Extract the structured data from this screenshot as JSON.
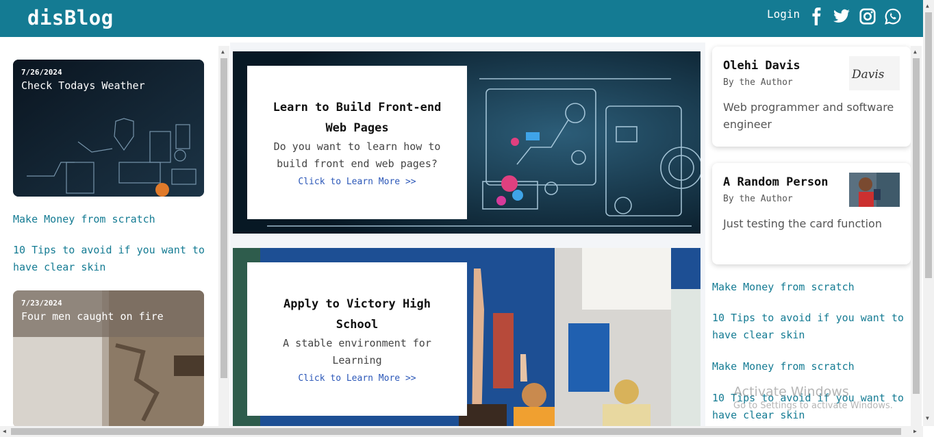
{
  "header": {
    "brand": "disBlog",
    "login_label": "Login",
    "social_icons": [
      "facebook-icon",
      "twitter-icon",
      "instagram-icon",
      "whatsapp-icon"
    ],
    "background_color": "#147b93"
  },
  "left": {
    "cards": [
      {
        "date": "7/26/2024",
        "title": "Check Todays Weather"
      },
      {
        "date": "7/23/2024",
        "title": "Four men caught on fire"
      }
    ],
    "links": [
      "Make Money from scratch",
      "10 Tips to avoid if you want to have clear skin"
    ]
  },
  "hero": [
    {
      "title": "Learn to Build Front-end Web Pages",
      "description": "Do you want to learn how to build front end web pages?",
      "link": "Click to Learn More >>"
    },
    {
      "title": "Apply to Victory High School",
      "description": "A stable environment for Learning",
      "link": "Click to Learn More >>"
    }
  ],
  "authors": [
    {
      "name": "Olehi Davis",
      "role": "By the Author",
      "bio": "Web programmer and software engineer",
      "signature": "Davis"
    },
    {
      "name": "A Random Person",
      "role": "By the Author",
      "bio": "Just testing the card function"
    }
  ],
  "right_links": [
    "Make Money from scratch",
    "10 Tips to avoid if you want to have clear skin",
    "Make Money from scratch",
    "10 Tips to avoid if you want to have clear skin"
  ],
  "watermark": {
    "line1": "Activate Windows",
    "line2": "Go to Settings to activate Windows."
  },
  "colors": {
    "link": "#147b93",
    "accent_link": "#2b57b8"
  }
}
